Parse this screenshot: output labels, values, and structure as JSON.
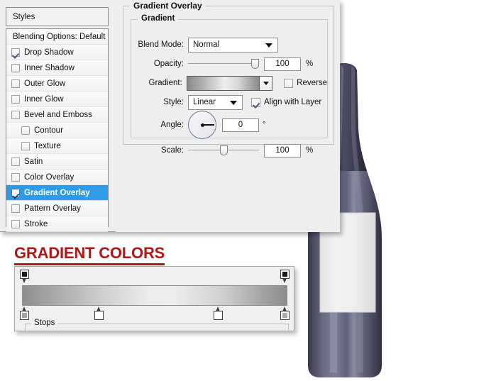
{
  "dialog": {
    "styles_header": "Styles",
    "blending_options": "Blending Options: Default",
    "style_items": [
      {
        "label": "Drop Shadow",
        "checked": true,
        "indent": false,
        "selected": false
      },
      {
        "label": "Inner Shadow",
        "checked": false,
        "indent": false,
        "selected": false
      },
      {
        "label": "Outer Glow",
        "checked": false,
        "indent": false,
        "selected": false
      },
      {
        "label": "Inner Glow",
        "checked": false,
        "indent": false,
        "selected": false
      },
      {
        "label": "Bevel and Emboss",
        "checked": false,
        "indent": false,
        "selected": false
      },
      {
        "label": "Contour",
        "checked": false,
        "indent": true,
        "selected": false
      },
      {
        "label": "Texture",
        "checked": false,
        "indent": true,
        "selected": false
      },
      {
        "label": "Satin",
        "checked": false,
        "indent": false,
        "selected": false
      },
      {
        "label": "Color Overlay",
        "checked": false,
        "indent": false,
        "selected": false
      },
      {
        "label": "Gradient Overlay",
        "checked": true,
        "indent": false,
        "selected": true
      },
      {
        "label": "Pattern Overlay",
        "checked": false,
        "indent": false,
        "selected": false
      },
      {
        "label": "Stroke",
        "checked": false,
        "indent": false,
        "selected": false
      }
    ]
  },
  "gradient_overlay": {
    "group_title": "Gradient Overlay",
    "subgroup_title": "Gradient",
    "blend_mode": {
      "label": "Blend Mode:",
      "value": "Normal"
    },
    "opacity": {
      "label": "Opacity:",
      "value": "100",
      "unit": "%",
      "percent": 100
    },
    "gradient": {
      "label": "Gradient:"
    },
    "reverse": {
      "label": "Reverse",
      "checked": false
    },
    "style": {
      "label": "Style:",
      "value": "Linear"
    },
    "align_with_layer": {
      "label": "Align with Layer",
      "checked": true
    },
    "angle": {
      "label": "Angle:",
      "value": "0",
      "unit": "°",
      "degrees": 0
    },
    "scale": {
      "label": "Scale:",
      "value": "100",
      "unit": "%",
      "percent": 50
    }
  },
  "gradient_editor": {
    "title": "GRADIENT COLORS",
    "stops_label": "Stops",
    "opacity_stops": [
      {
        "position_pct": 1,
        "color": "#1a1a1a"
      },
      {
        "position_pct": 99,
        "color": "#1a1a1a"
      }
    ],
    "color_stops": [
      {
        "position_pct": 1,
        "color": "#a0a0a0"
      },
      {
        "position_pct": 29,
        "color": "#ffffff"
      },
      {
        "position_pct": 74,
        "color": "#ffffff"
      },
      {
        "position_pct": 99,
        "color": "#a8a8a8"
      }
    ]
  },
  "artwork": {
    "name": "wine-bottle",
    "glass_dark": "#2b2b3c",
    "glass_mid": "#5c5a74",
    "glass_light": "#807e99",
    "label_color": "#e9e9e9"
  },
  "colors": {
    "accent_red": "#b01717",
    "selection_blue": "#2f9ae8",
    "dialog_bg": "#eeeeee"
  }
}
